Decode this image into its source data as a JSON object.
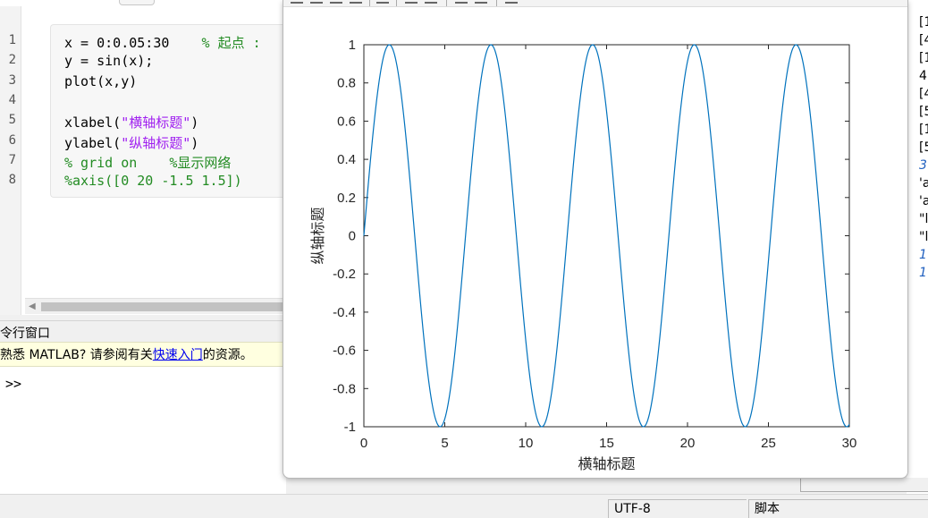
{
  "editor": {
    "line_numbers": [
      "1",
      "2",
      "3",
      "4",
      "5",
      "6",
      "7",
      "8"
    ],
    "lines": [
      [
        {
          "t": "x = 0:0.05:30    ",
          "k": "code"
        },
        {
          "t": "% 起点 :",
          "k": "comment"
        }
      ],
      [
        {
          "t": "y = sin(x);",
          "k": "code"
        }
      ],
      [
        {
          "t": "plot(x,y)",
          "k": "code"
        }
      ],
      [
        {
          "t": "",
          "k": "code"
        }
      ],
      [
        {
          "t": "xlabel(",
          "k": "code"
        },
        {
          "t": "\"横轴标题\"",
          "k": "string"
        },
        {
          "t": ")",
          "k": "code"
        }
      ],
      [
        {
          "t": "ylabel(",
          "k": "code"
        },
        {
          "t": "\"纵轴标题\"",
          "k": "string"
        },
        {
          "t": ")",
          "k": "code"
        }
      ],
      [
        {
          "t": "% grid on    %显示网络",
          "k": "comment"
        }
      ],
      [
        {
          "t": "%axis([0 20 -1.5 1.5])",
          "k": "comment"
        }
      ]
    ]
  },
  "command_window": {
    "title": "令行窗口",
    "notice_prefix": "熟悉 MATLAB? 请参阅有关",
    "notice_link": "快速入门",
    "notice_suffix": "的资源。",
    "prompt": ">>"
  },
  "workspace": {
    "lines": [
      "[1",
      "[4",
      "[1",
      "4",
      "[4",
      "[5",
      "[1",
      "[5",
      "3",
      "'a",
      "'a",
      "\"l",
      "\"l",
      "1",
      "1"
    ],
    "italic_indices": [
      8,
      13,
      14
    ]
  },
  "statusbar": {
    "encoding": "UTF-8",
    "file_type": "脚本"
  },
  "colors": {
    "line": "#0072bd",
    "comment": "#228b22",
    "string": "#a020f0",
    "link": "#0000ee"
  },
  "chart_data": {
    "type": "line",
    "function": "sin(x)",
    "x_start": 0,
    "x_step": 0.05,
    "x_end": 30,
    "xlabel": "横轴标题",
    "ylabel": "纵轴标题",
    "xlim": [
      0,
      30
    ],
    "ylim": [
      -1,
      1
    ],
    "xticks": [
      "0",
      "5",
      "10",
      "15",
      "20",
      "25",
      "30"
    ],
    "yticks": [
      "-1",
      "-0.8",
      "-0.6",
      "-0.4",
      "-0.2",
      "0",
      "0.2",
      "0.4",
      "0.6",
      "0.8",
      "1"
    ],
    "grid": false
  }
}
